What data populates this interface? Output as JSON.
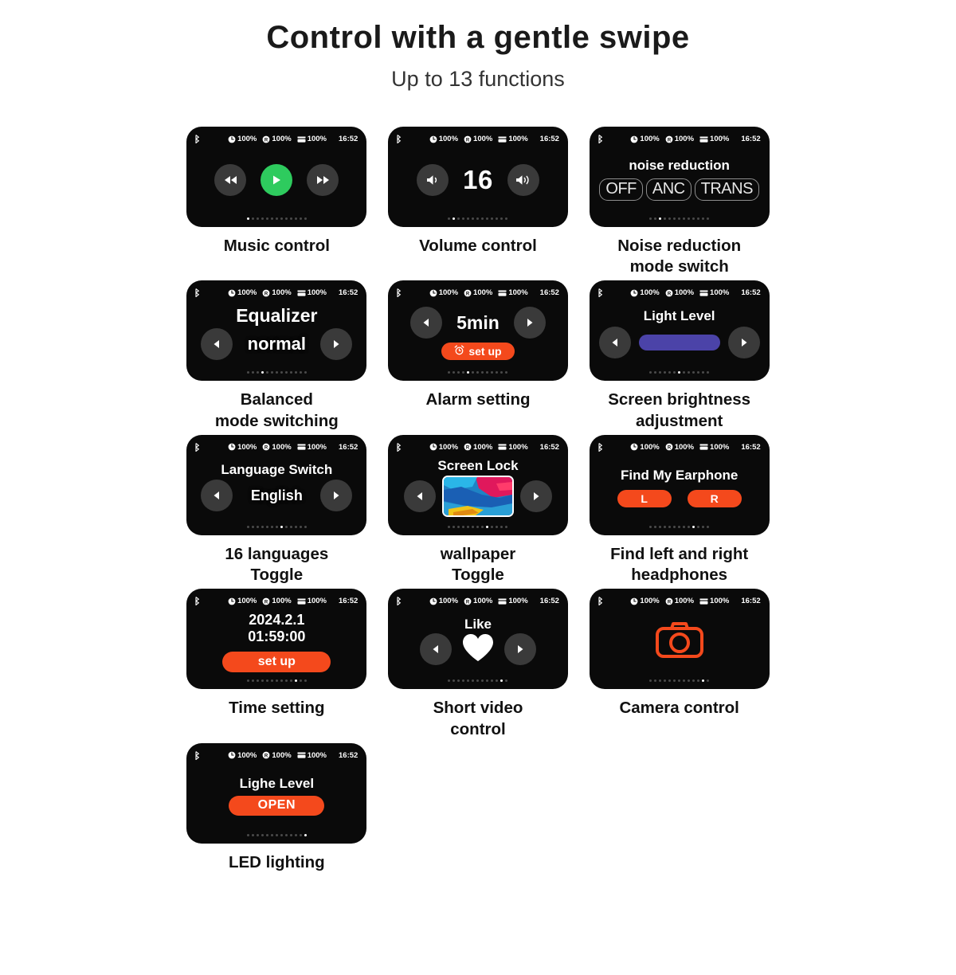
{
  "header": {
    "title": "Control with a gentle swipe",
    "subtitle": "Up to 13 functions"
  },
  "statusbar": {
    "left_battery": "100%",
    "right_battery": "100%",
    "case_battery": "100%",
    "time": "16:52",
    "icons": [
      "bluetooth-icon",
      "left-earbud-icon",
      "right-earbud-icon",
      "case-battery-icon"
    ]
  },
  "colors": {
    "accent_orange": "#f4491c",
    "play_green": "#2ecb5e",
    "slider_purple": "#4b43a8",
    "button_grey": "#3a3a3a",
    "screen_black": "#0a0a0a"
  },
  "cards": [
    {
      "id": "music-control",
      "caption": "Music control",
      "active_dot": 0,
      "dot_count": 13,
      "controls": {
        "prev": "rewind-icon",
        "play": "play-icon",
        "next": "fast-forward-icon"
      }
    },
    {
      "id": "volume-control",
      "caption": "Volume control",
      "active_dot": 1,
      "dot_count": 13,
      "value": "16",
      "controls": {
        "down": "volume-down-icon",
        "up": "volume-up-icon"
      }
    },
    {
      "id": "noise-reduction",
      "caption": "Noise reduction\nmode switch",
      "active_dot": 2,
      "dot_count": 13,
      "title": "noise reduction",
      "modes": [
        "OFF",
        "ANC",
        "TRANS"
      ]
    },
    {
      "id": "equalizer",
      "caption": "Balanced\nmode switching",
      "active_dot": 3,
      "dot_count": 13,
      "title": "Equalizer",
      "value": "normal"
    },
    {
      "id": "alarm-setting",
      "caption": "Alarm setting",
      "active_dot": 4,
      "dot_count": 13,
      "value": "5min",
      "button_label": "set up",
      "button_icon": "alarm-clock-icon"
    },
    {
      "id": "screen-brightness",
      "caption": "Screen brightness\nadjustment",
      "active_dot": 6,
      "dot_count": 13,
      "title": "Light Level",
      "slider_fill_pct": 100
    },
    {
      "id": "language-switch",
      "caption": "16 languages\nToggle",
      "active_dot": 7,
      "dot_count": 13,
      "title": "Language Switch",
      "value": "English"
    },
    {
      "id": "screen-lock",
      "caption": "wallpaper\nToggle",
      "active_dot": 8,
      "dot_count": 13,
      "title": "Screen Lock",
      "thumbnail": "wallpaper-thumbnail"
    },
    {
      "id": "find-my-earphone",
      "caption": "Find left and right\nheadphones",
      "active_dot": 9,
      "dot_count": 13,
      "title": "Find My Earphone",
      "buttons": [
        "L",
        "R"
      ]
    },
    {
      "id": "time-setting",
      "caption": "Time setting",
      "active_dot": 10,
      "dot_count": 13,
      "date": "2024.2.1",
      "time": "01:59:00",
      "button_label": "set up"
    },
    {
      "id": "short-video-control",
      "caption": "Short video\ncontrol",
      "active_dot": 11,
      "dot_count": 13,
      "title": "Like",
      "icon": "heart-icon"
    },
    {
      "id": "camera-control",
      "caption": "Camera control",
      "active_dot": 12,
      "dot_count": 13,
      "icon": "camera-icon"
    },
    {
      "id": "led-lighting",
      "caption": "LED lighting",
      "active_dot": 12,
      "dot_count": 13,
      "title": "Lighe Level",
      "button_label": "OPEN"
    }
  ]
}
